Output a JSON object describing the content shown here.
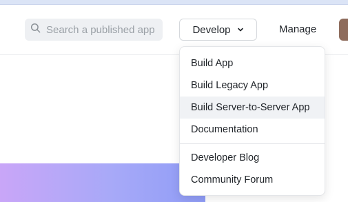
{
  "search": {
    "placeholder": "Search a published app",
    "value": ""
  },
  "nav": {
    "develop_label": "Develop",
    "manage_label": "Manage"
  },
  "develop_menu": {
    "items": [
      {
        "label": "Build App"
      },
      {
        "label": "Build Legacy App"
      },
      {
        "label": "Build Server-to-Server App",
        "hovered": true
      },
      {
        "label": "Documentation"
      }
    ],
    "secondary_items": [
      {
        "label": "Developer Blog"
      },
      {
        "label": "Community Forum"
      }
    ]
  },
  "icons": {
    "search": "search-icon",
    "chevron": "chevron-down-icon"
  },
  "colors": {
    "search_bg": "#eef0f3",
    "hover_bg": "#f0f2f5",
    "avatar": "#8e6c5c",
    "hero_gradient_start": "#c9a6f8",
    "hero_gradient_end": "#8f9cf6"
  }
}
